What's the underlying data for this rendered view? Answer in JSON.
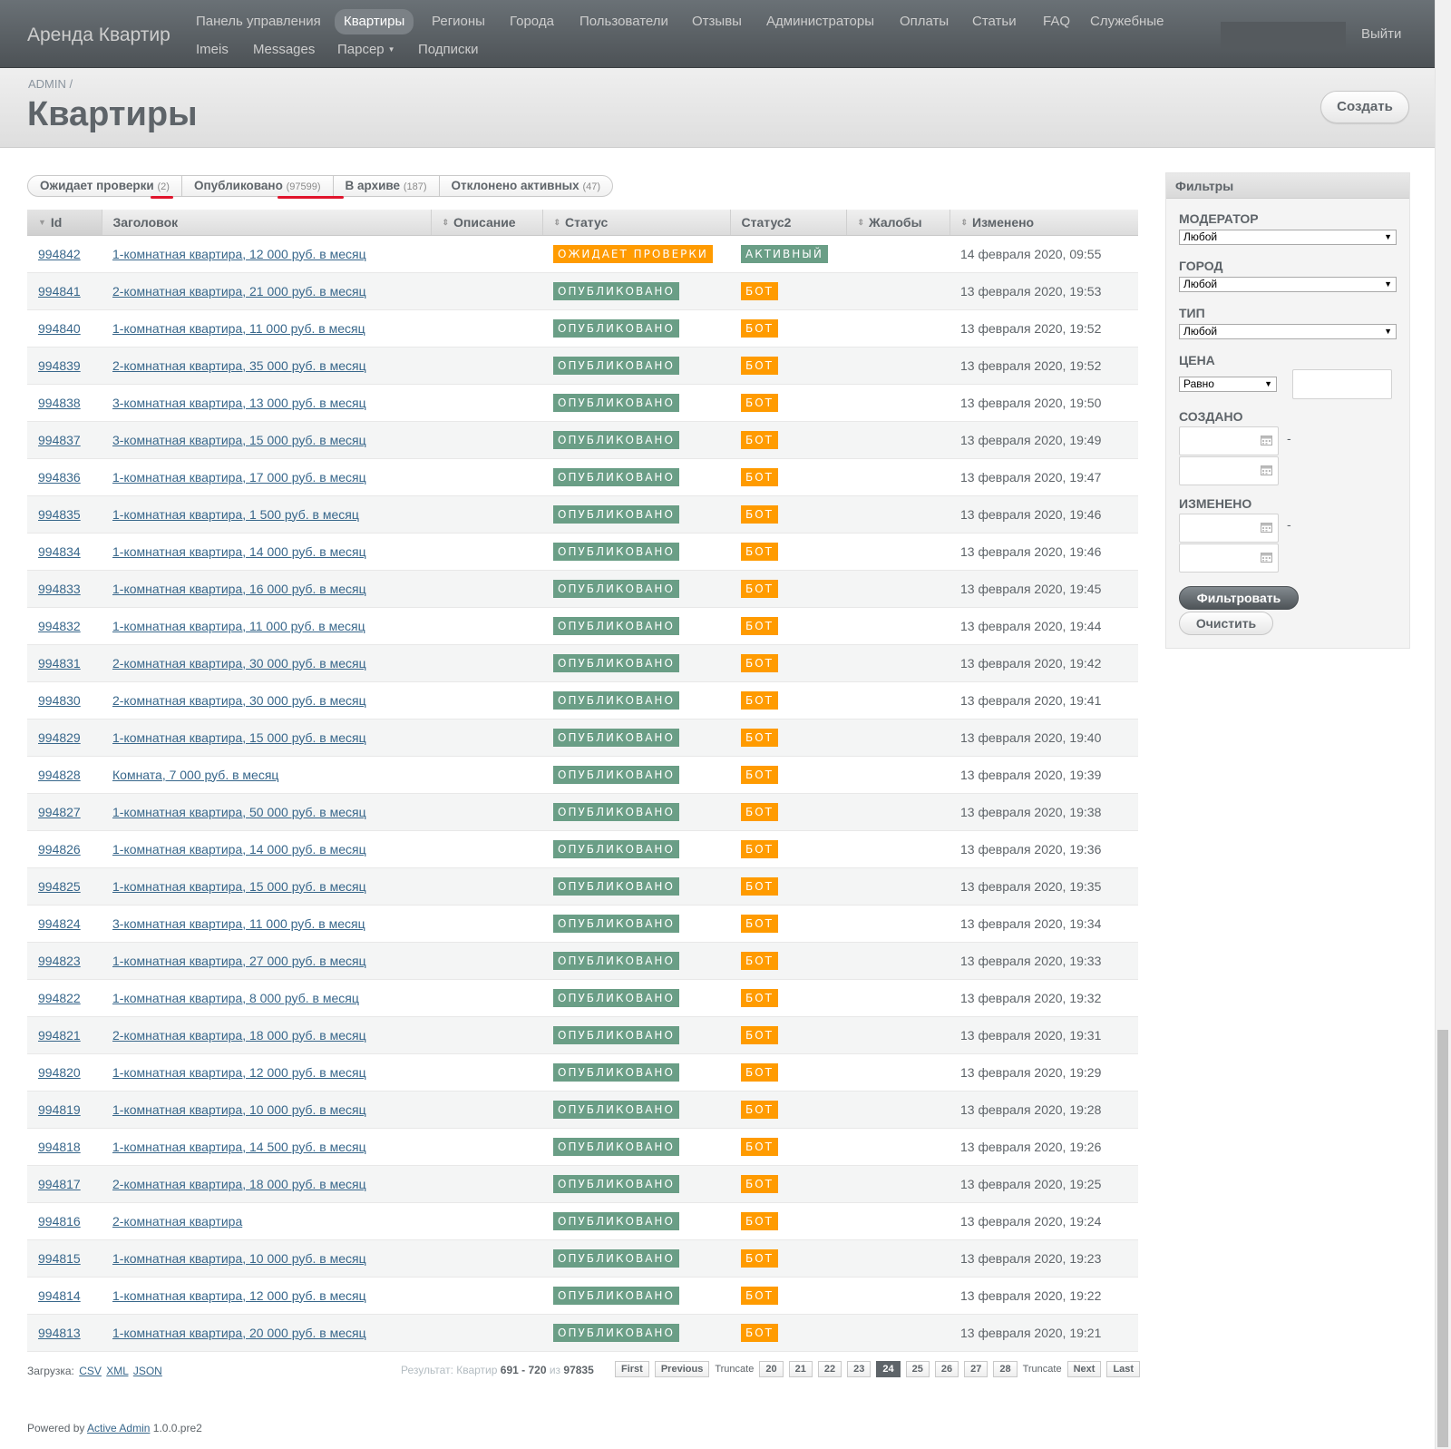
{
  "header": {
    "site_title": "Аренда Квартир",
    "nav": [
      "Панель управления",
      "Квартиры",
      "Регионы",
      "Города",
      "Пользователи",
      "Отзывы",
      "Администраторы",
      "Оплаты",
      "Статьи",
      "FAQ",
      "Служебные",
      "Imeis",
      "Messages",
      "Парсер",
      "Подписки"
    ],
    "current_nav": "Квартиры",
    "logout": "Выйти"
  },
  "title_bar": {
    "breadcrumb": "ADMIN",
    "breadcrumb_sep": "/",
    "title": "Квартиры",
    "create_label": "Создать"
  },
  "scopes": [
    {
      "label": "Ожидает проверки",
      "count": "(2)"
    },
    {
      "label": "Опубликовано",
      "count": "(97599)"
    },
    {
      "label": "В архиве",
      "count": "(187)"
    },
    {
      "label": "Отклонено активных",
      "count": "(47)"
    }
  ],
  "table": {
    "columns": [
      "Id",
      "Заголовок",
      "Описание",
      "Статус",
      "Статус2",
      "Жалобы",
      "Изменено"
    ],
    "rows": [
      {
        "id": "994842",
        "title": "1-комнатная квартира, 12 000 руб. в месяц",
        "status": "ОЖИДАЕТ ПРОВЕРКИ",
        "status2": "АКТИВНЫЙ",
        "date": "14 февраля 2020, 09:55"
      },
      {
        "id": "994841",
        "title": "2-комнатная квартира, 21 000 руб. в месяц",
        "status": "ОПУБЛИКОВАНО",
        "status2": "БОТ",
        "date": "13 февраля 2020, 19:53"
      },
      {
        "id": "994840",
        "title": "1-комнатная квартира, 11 000 руб. в месяц",
        "status": "ОПУБЛИКОВАНО",
        "status2": "БОТ",
        "date": "13 февраля 2020, 19:52"
      },
      {
        "id": "994839",
        "title": "2-комнатная квартира, 35 000 руб. в месяц",
        "status": "ОПУБЛИКОВАНО",
        "status2": "БОТ",
        "date": "13 февраля 2020, 19:52"
      },
      {
        "id": "994838",
        "title": "3-комнатная квартира, 13 000 руб. в месяц",
        "status": "ОПУБЛИКОВАНО",
        "status2": "БОТ",
        "date": "13 февраля 2020, 19:50"
      },
      {
        "id": "994837",
        "title": "3-комнатная квартира, 15 000 руб. в месяц",
        "status": "ОПУБЛИКОВАНО",
        "status2": "БОТ",
        "date": "13 февраля 2020, 19:49"
      },
      {
        "id": "994836",
        "title": "1-комнатная квартира, 17 000 руб. в месяц",
        "status": "ОПУБЛИКОВАНО",
        "status2": "БОТ",
        "date": "13 февраля 2020, 19:47"
      },
      {
        "id": "994835",
        "title": "1-комнатная квартира, 1 500 руб. в месяц",
        "status": "ОПУБЛИКОВАНО",
        "status2": "БОТ",
        "date": "13 февраля 2020, 19:46"
      },
      {
        "id": "994834",
        "title": "1-комнатная квартира, 14 000 руб. в месяц",
        "status": "ОПУБЛИКОВАНО",
        "status2": "БОТ",
        "date": "13 февраля 2020, 19:46"
      },
      {
        "id": "994833",
        "title": "1-комнатная квартира, 16 000 руб. в месяц",
        "status": "ОПУБЛИКОВАНО",
        "status2": "БОТ",
        "date": "13 февраля 2020, 19:45"
      },
      {
        "id": "994832",
        "title": "1-комнатная квартира, 11 000 руб. в месяц",
        "status": "ОПУБЛИКОВАНО",
        "status2": "БОТ",
        "date": "13 февраля 2020, 19:44"
      },
      {
        "id": "994831",
        "title": "2-комнатная квартира, 30 000 руб. в месяц",
        "status": "ОПУБЛИКОВАНО",
        "status2": "БОТ",
        "date": "13 февраля 2020, 19:42"
      },
      {
        "id": "994830",
        "title": "2-комнатная квартира, 30 000 руб. в месяц",
        "status": "ОПУБЛИКОВАНО",
        "status2": "БОТ",
        "date": "13 февраля 2020, 19:41"
      },
      {
        "id": "994829",
        "title": "1-комнатная квартира, 15 000 руб. в месяц",
        "status": "ОПУБЛИКОВАНО",
        "status2": "БОТ",
        "date": "13 февраля 2020, 19:40"
      },
      {
        "id": "994828",
        "title": "Комната, 7 000 руб. в месяц",
        "status": "ОПУБЛИКОВАНО",
        "status2": "БОТ",
        "date": "13 февраля 2020, 19:39"
      },
      {
        "id": "994827",
        "title": "1-комнатная квартира, 50 000 руб. в месяц",
        "status": "ОПУБЛИКОВАНО",
        "status2": "БОТ",
        "date": "13 февраля 2020, 19:38"
      },
      {
        "id": "994826",
        "title": "1-комнатная квартира, 14 000 руб. в месяц",
        "status": "ОПУБЛИКОВАНО",
        "status2": "БОТ",
        "date": "13 февраля 2020, 19:36"
      },
      {
        "id": "994825",
        "title": "1-комнатная квартира, 15 000 руб. в месяц",
        "status": "ОПУБЛИКОВАНО",
        "status2": "БОТ",
        "date": "13 февраля 2020, 19:35"
      },
      {
        "id": "994824",
        "title": "3-комнатная квартира, 11 000 руб. в месяц",
        "status": "ОПУБЛИКОВАНО",
        "status2": "БОТ",
        "date": "13 февраля 2020, 19:34"
      },
      {
        "id": "994823",
        "title": "1-комнатная квартира, 27 000 руб. в месяц",
        "status": "ОПУБЛИКОВАНО",
        "status2": "БОТ",
        "date": "13 февраля 2020, 19:33"
      },
      {
        "id": "994822",
        "title": "1-комнатная квартира, 8 000 руб. в месяц",
        "status": "ОПУБЛИКОВАНО",
        "status2": "БОТ",
        "date": "13 февраля 2020, 19:32"
      },
      {
        "id": "994821",
        "title": "2-комнатная квартира, 18 000 руб. в месяц",
        "status": "ОПУБЛИКОВАНО",
        "status2": "БОТ",
        "date": "13 февраля 2020, 19:31"
      },
      {
        "id": "994820",
        "title": "1-комнатная квартира, 12 000 руб. в месяц",
        "status": "ОПУБЛИКОВАНО",
        "status2": "БОТ",
        "date": "13 февраля 2020, 19:29"
      },
      {
        "id": "994819",
        "title": "1-комнатная квартира, 10 000 руб. в месяц",
        "status": "ОПУБЛИКОВАНО",
        "status2": "БОТ",
        "date": "13 февраля 2020, 19:28"
      },
      {
        "id": "994818",
        "title": "1-комнатная квартира, 14 500 руб. в месяц",
        "status": "ОПУБЛИКОВАНО",
        "status2": "БОТ",
        "date": "13 февраля 2020, 19:26"
      },
      {
        "id": "994817",
        "title": "2-комнатная квартира, 18 000 руб. в месяц",
        "status": "ОПУБЛИКОВАНО",
        "status2": "БОТ",
        "date": "13 февраля 2020, 19:25"
      },
      {
        "id": "994816",
        "title": "2-комнатная квартира",
        "status": "ОПУБЛИКОВАНО",
        "status2": "БОТ",
        "date": "13 февраля 2020, 19:24"
      },
      {
        "id": "994815",
        "title": "1-комнатная квартира, 10 000 руб. в месяц",
        "status": "ОПУБЛИКОВАНО",
        "status2": "БОТ",
        "date": "13 февраля 2020, 19:23"
      },
      {
        "id": "994814",
        "title": "1-комнатная квартира, 12 000 руб. в месяц",
        "status": "ОПУБЛИКОВАНО",
        "status2": "БОТ",
        "date": "13 февраля 2020, 19:22"
      },
      {
        "id": "994813",
        "title": "1-комнатная квартира, 20 000 руб. в месяц",
        "status": "ОПУБЛИКОВАНО",
        "status2": "БОТ",
        "date": "13 февраля 2020, 19:21"
      }
    ]
  },
  "downloads": {
    "label": "Загрузка:",
    "csv": "CSV",
    "xml": "XML",
    "json": "JSON"
  },
  "pagination": {
    "info_prefix": "Результат: Квартир",
    "range": "691 - 720",
    "of": "из",
    "total": "97835",
    "first": "First",
    "previous": "Previous",
    "truncate": "Truncate",
    "pages": [
      "20",
      "21",
      "22",
      "23",
      "24",
      "25",
      "26",
      "27",
      "28"
    ],
    "current_page": "24",
    "next": "Next",
    "last": "Last"
  },
  "footer": {
    "powered_by": "Powered by",
    "link": "Active Admin",
    "version": "1.0.0.pre2"
  },
  "filters": {
    "title": "Фильтры",
    "moderator_label": "МОДЕРАТОР",
    "moderator_value": "Любой",
    "city_label": "ГОРОД",
    "city_value": "Любой",
    "type_label": "ТИП",
    "type_value": "Любой",
    "price_label": "ЦЕНА",
    "price_op": "Равно",
    "created_label": "СОЗДАНО",
    "changed_label": "ИЗМЕНЕНО",
    "range_sep": "-",
    "filter_btn": "Фильтровать",
    "clear_btn": "Очистить"
  },
  "colors": {
    "status_pending": "#ff9b00",
    "status_published": "#6a9e86",
    "status_bot": "#ff9b00",
    "link": "#38678b",
    "header_bg": "#5b6166"
  }
}
